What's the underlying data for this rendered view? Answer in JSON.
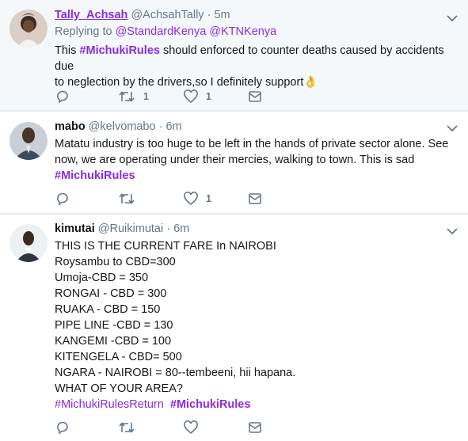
{
  "tweets": [
    {
      "name": "Tally_Achsah",
      "handle": "@AchsahTally",
      "time": "5m",
      "replying_label": "Replying to",
      "mentions": [
        "@StandardKenya",
        "@KTNKenya"
      ],
      "text_before": "This ",
      "hashtag": "#MichukiRules",
      "text_after_line1": " should enforced to counter deaths caused by accidents due",
      "text_line2": "to neglection by the drivers,so I definitely support",
      "emoji": "👌",
      "retweets": "1",
      "likes": "1"
    },
    {
      "name": "mabo",
      "handle": "@kelvomabo",
      "time": "6m",
      "lines": [
        "Matatu industry is too huge to be  left in the hands of private sector alone. See",
        "now, we are operating under their mercies, walking to town. This is sad"
      ],
      "hashtag": "#MichukiRules",
      "retweets": "",
      "likes": "1"
    },
    {
      "name": "kimutai",
      "handle": "@Ruikimutai",
      "time": "6m",
      "lines": [
        "THIS IS THE CURRENT FARE In NAIROBI",
        "Roysambu to CBD=300",
        "Umoja-CBD = 350",
        "RONGAI - CBD = 300",
        "RUAKA - CBD = 150",
        "PIPE LINE -CBD = 130",
        "KANGEMI -CBD = 100",
        "KITENGELA - CBD= 500",
        "NGARA - NAIROBI = 80--tembeeni, hii hapana.",
        "WHAT OF YOUR AREA?"
      ],
      "hashtag1": "#MichukiRulesReturn",
      "hashtag2": "#MichukiRules"
    }
  ],
  "dot": "·",
  "icons": [
    "reply-icon",
    "retweet-icon",
    "like-icon",
    "message-icon",
    "chevron-down-icon"
  ],
  "colors": {
    "hashtag": "#8a2be2",
    "muted": "#657786",
    "divider": "#e6ecf0"
  }
}
